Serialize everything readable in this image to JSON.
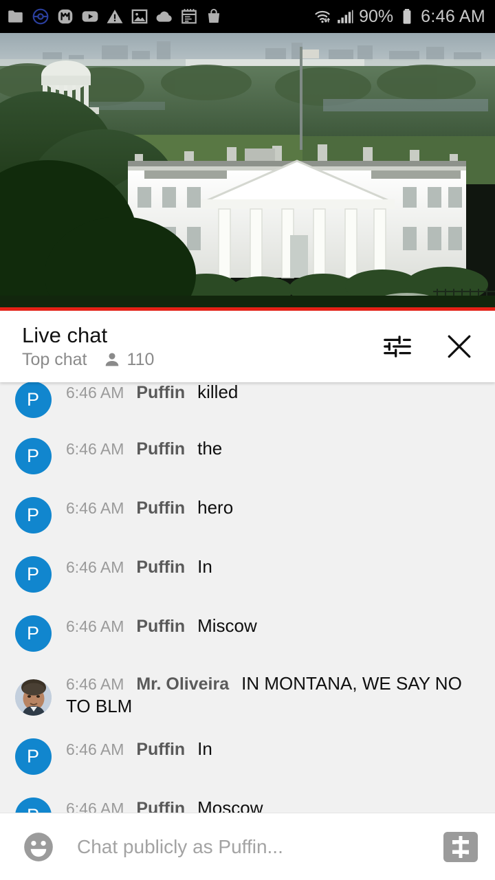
{
  "status_bar": {
    "icons": [
      "folder-icon",
      "pokeball-icon",
      "m-app-icon",
      "youtube-icon",
      "warning-icon",
      "photos-icon",
      "cloud-icon",
      "calendar-icon",
      "shopping-bag-icon"
    ],
    "wifi_icon": "wifi-icon",
    "signal_icon": "cell-signal-icon",
    "battery_percent": "90%",
    "battery_icon": "battery-icon",
    "time": "6:46 AM",
    "background": "#000000",
    "text_color": "#c9c9c9"
  },
  "video": {
    "name": "white-house-live-stream",
    "description": "Live view of the White House with the Jefferson Memorial and Washington DC skyline in the background",
    "progress_bar_color": "#e62117",
    "progress_percent": 100
  },
  "chat_header": {
    "title": "Live chat",
    "mode": "Top chat",
    "viewer_icon": "person-icon",
    "viewer_count": "110",
    "settings_icon": "tune-sliders-icon",
    "close_icon": "close-icon"
  },
  "messages": [
    {
      "avatar_type": "initial",
      "initial": "P",
      "avatar_color": "#1186ce",
      "time": "6:46 AM",
      "author": "Puffin",
      "text": "killed"
    },
    {
      "avatar_type": "initial",
      "initial": "P",
      "avatar_color": "#1186ce",
      "time": "6:46 AM",
      "author": "Puffin",
      "text": "the"
    },
    {
      "avatar_type": "initial",
      "initial": "P",
      "avatar_color": "#1186ce",
      "time": "6:46 AM",
      "author": "Puffin",
      "text": "hero"
    },
    {
      "avatar_type": "initial",
      "initial": "P",
      "avatar_color": "#1186ce",
      "time": "6:46 AM",
      "author": "Puffin",
      "text": "In"
    },
    {
      "avatar_type": "initial",
      "initial": "P",
      "avatar_color": "#1186ce",
      "time": "6:46 AM",
      "author": "Puffin",
      "text": "Miscow"
    },
    {
      "avatar_type": "photo",
      "initial": "",
      "avatar_color": "#b9c6d6",
      "time": "6:46 AM",
      "author": "Mr. Oliveira",
      "text": "IN MONTANA, WE SAY NO TO BLM"
    },
    {
      "avatar_type": "initial",
      "initial": "P",
      "avatar_color": "#1186ce",
      "time": "6:46 AM",
      "author": "Puffin",
      "text": "In"
    },
    {
      "avatar_type": "initial",
      "initial": "P",
      "avatar_color": "#1186ce",
      "time": "6:46 AM",
      "author": "Puffin",
      "text": "Moscow"
    }
  ],
  "input_bar": {
    "emoji_icon": "emoji-smiley-icon",
    "placeholder": "Chat publicly as Puffin...",
    "value": "",
    "superchat_icon": "super-chat-dollar-icon"
  },
  "colors": {
    "chat_background": "#f1f1f1",
    "header_background": "#ffffff",
    "accent_red": "#e62117",
    "avatar_blue": "#1186ce",
    "muted_text": "#9a9a9a",
    "author_text": "#5a5a5a"
  }
}
